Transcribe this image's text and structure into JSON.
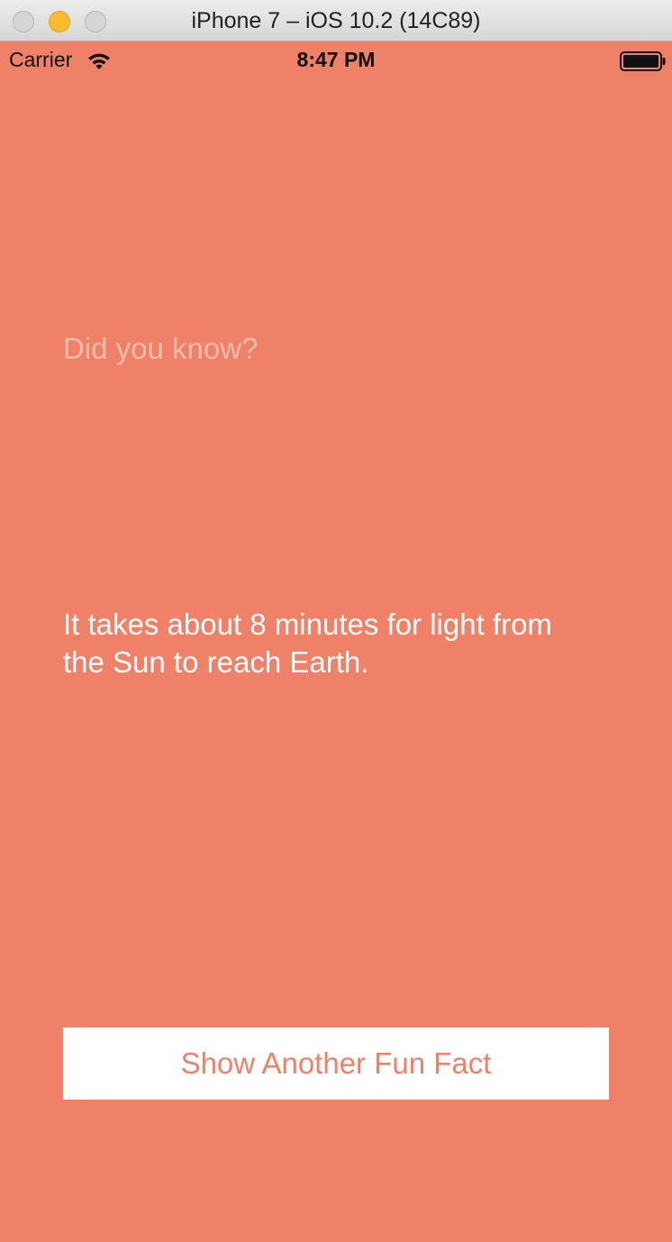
{
  "window": {
    "title": "iPhone 7 – iOS 10.2 (14C89)"
  },
  "status_bar": {
    "carrier": "Carrier",
    "wifi_icon": "wifi-icon",
    "time": "8:47 PM",
    "battery_icon": "battery-icon"
  },
  "content": {
    "heading": "Did you know?",
    "fact": "It takes about 8 minutes for light from the Sun to reach Earth.",
    "button_label": "Show Another Fun Fact"
  },
  "colors": {
    "background": "#ee8167",
    "button_background": "#ffffff",
    "button_text": "#ee8167",
    "fact_text": "#ffffff",
    "heading_text": "rgba(255,255,255,0.45)",
    "minimize_button": "#fdbc2f"
  }
}
